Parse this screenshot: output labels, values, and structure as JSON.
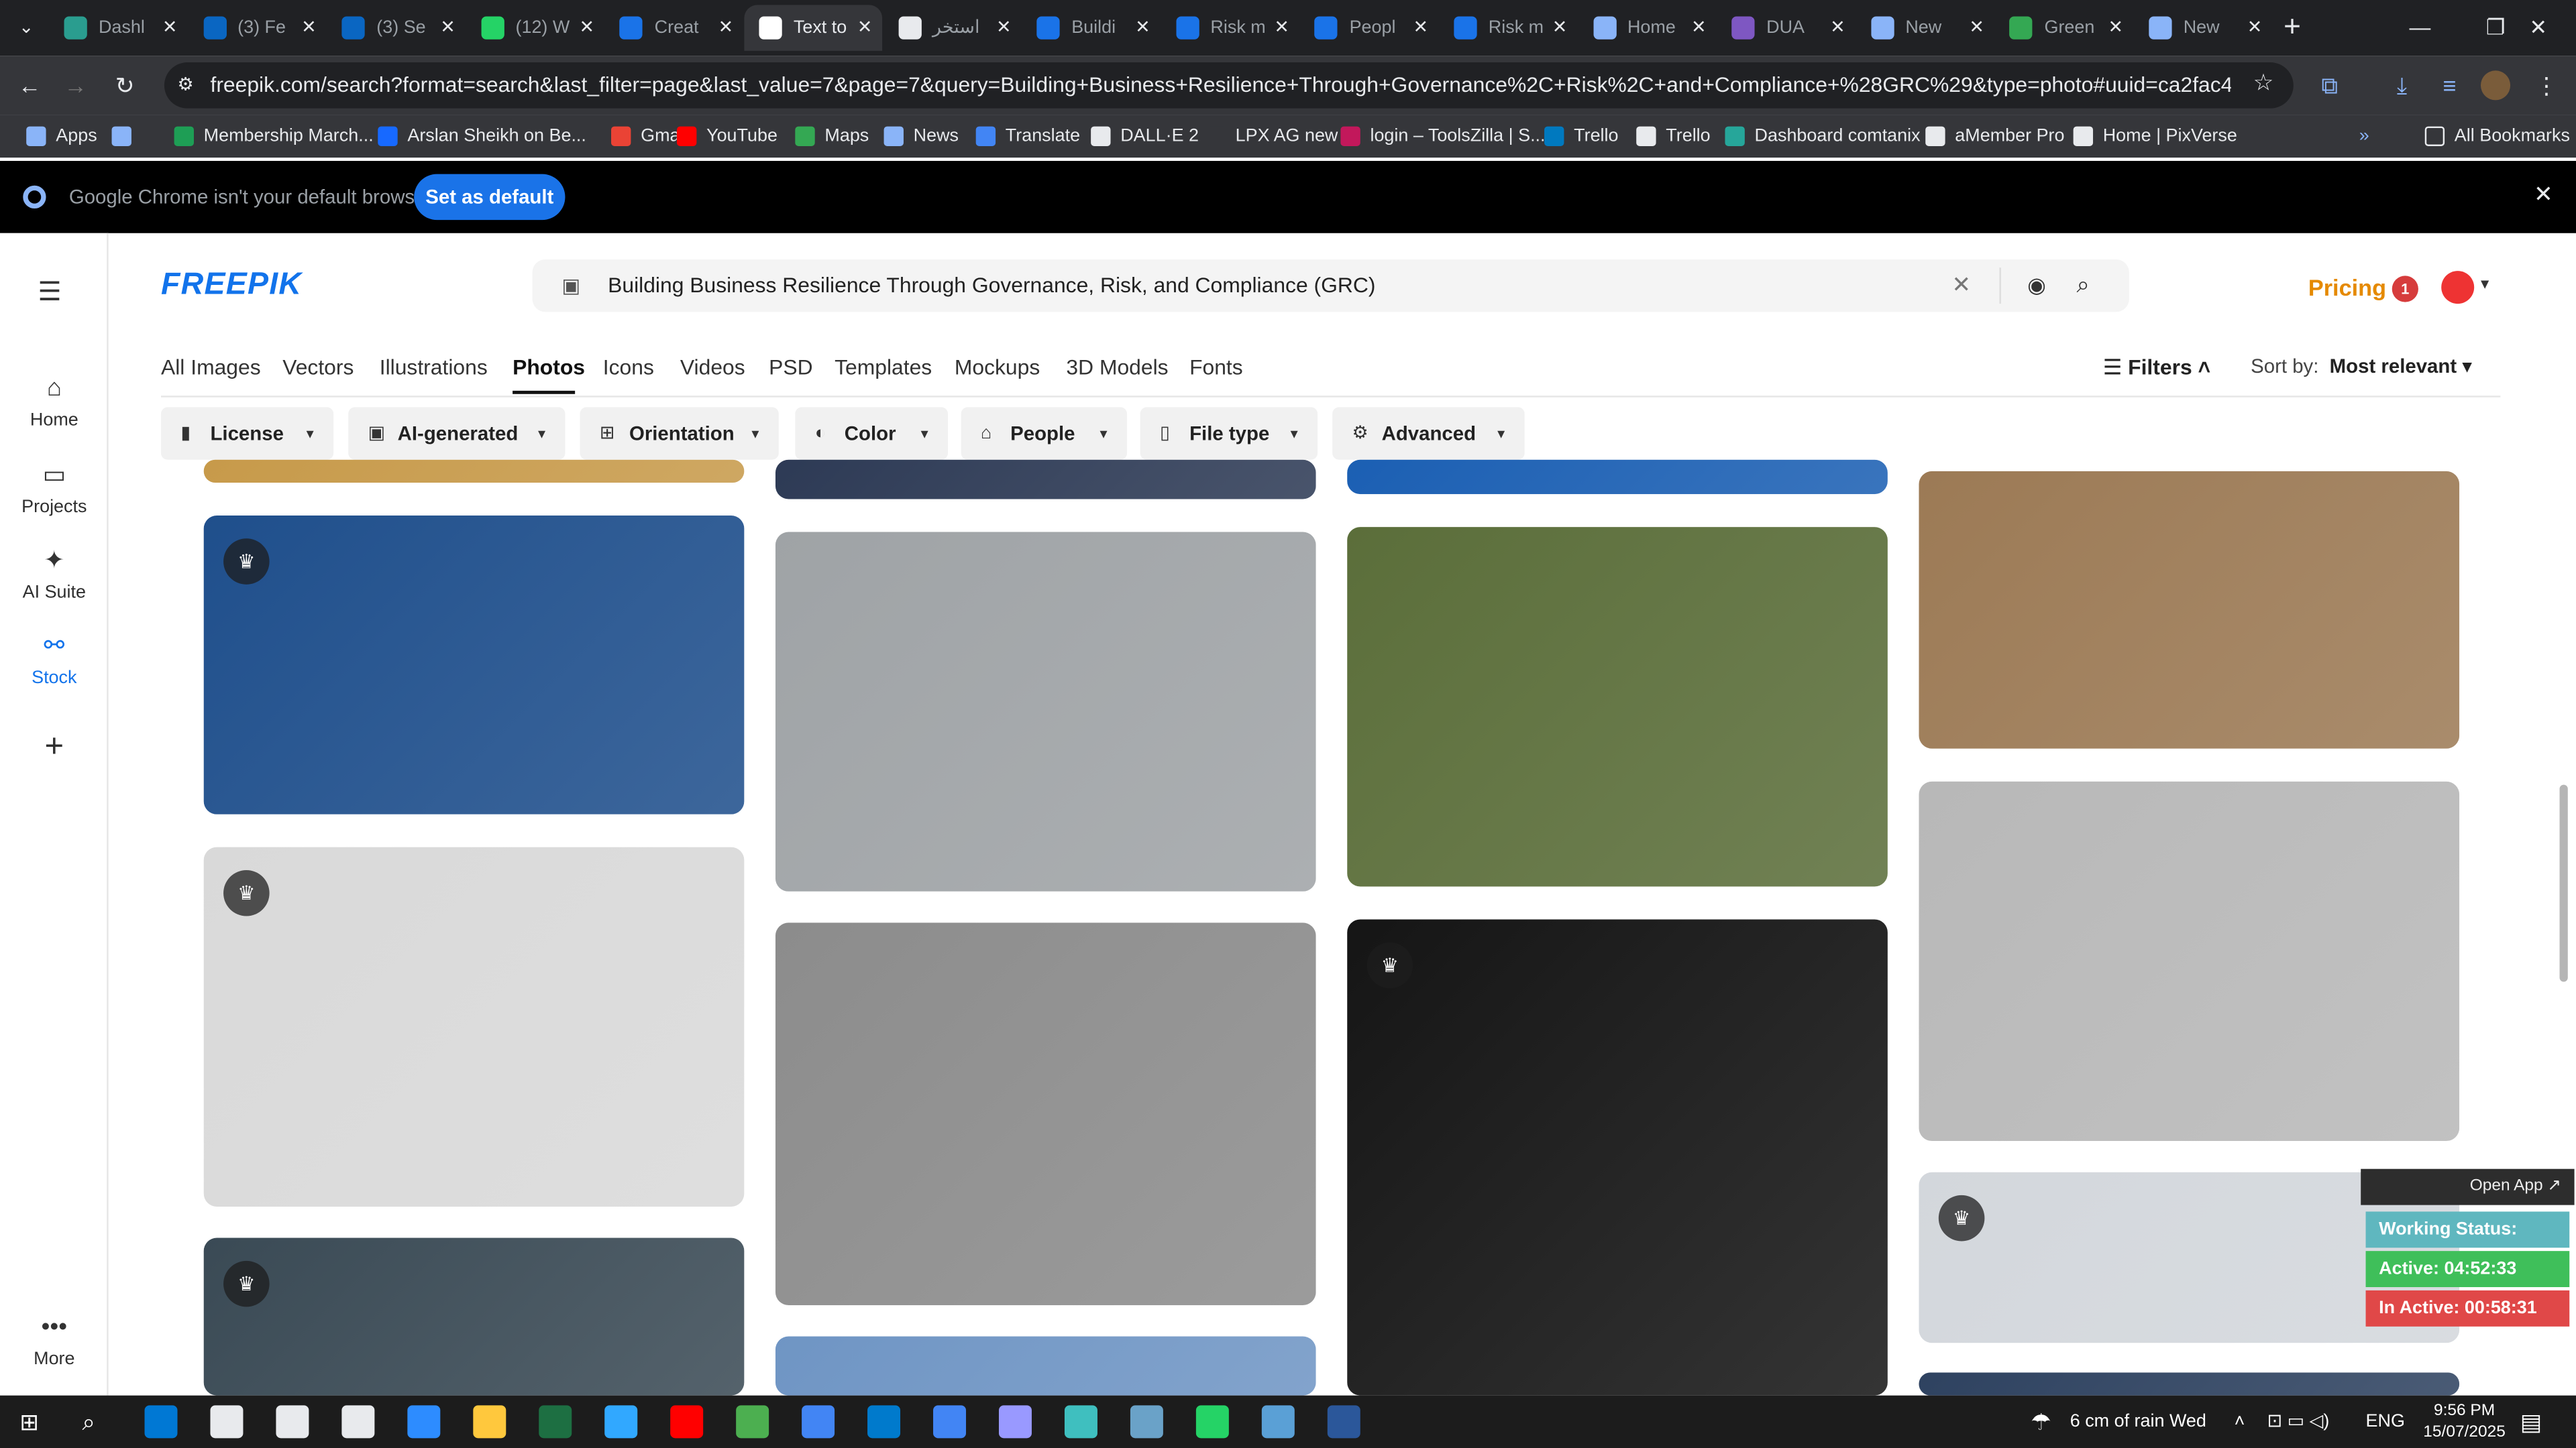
{
  "browser": {
    "tabs": [
      {
        "label": "Dashl",
        "color": "#2a9d8f",
        "active": false
      },
      {
        "label": "(3) Fe",
        "color": "#0a66c2",
        "active": false
      },
      {
        "label": "(3) Se",
        "color": "#0a66c2",
        "active": false
      },
      {
        "label": "(12) W",
        "color": "#25d366",
        "active": false
      },
      {
        "label": "Creat",
        "color": "#1a73e8",
        "active": false
      },
      {
        "label": "Text to",
        "color": "#ffffff",
        "active": true
      },
      {
        "label": "استخر",
        "color": "#e8eaed",
        "active": false
      },
      {
        "label": "Buildi",
        "color": "#1a73e8",
        "active": false
      },
      {
        "label": "Risk m",
        "color": "#1a73e8",
        "active": false
      },
      {
        "label": "Peopl",
        "color": "#1a73e8",
        "active": false
      },
      {
        "label": "Risk m",
        "color": "#1a73e8",
        "active": false
      },
      {
        "label": "Home",
        "color": "#8ab4f8",
        "active": false
      },
      {
        "label": "DUA",
        "color": "#7e57c2",
        "active": false
      },
      {
        "label": "New",
        "color": "#8ab4f8",
        "active": false
      },
      {
        "label": "Green",
        "color": "#34a853",
        "active": false
      },
      {
        "label": "New",
        "color": "#8ab4f8",
        "active": false
      }
    ],
    "url": "freepik.com/search?format=search&last_filter=page&last_value=7&page=7&query=Building+Business+Resilience+Through+Governance%2C+Risk%2C+and+Compliance+%28GRC%29&type=photo#uuid=ca2fac46-376d-4ca8-8abf-f91f3712...",
    "bookmarks": [
      {
        "label": "Apps",
        "color": "#8ab4f8"
      },
      {
        "label": "",
        "color": "#8ab4f8"
      },
      {
        "label": "Membership March...",
        "color": "#1e9e55"
      },
      {
        "label": "Arslan Sheikh on Be...",
        "color": "#1769ff"
      },
      {
        "label": "Gmail",
        "color": "#ea4335"
      },
      {
        "label": "YouTube",
        "color": "#ff0000"
      },
      {
        "label": "Maps",
        "color": "#34a853"
      },
      {
        "label": "News",
        "color": "#8ab4f8"
      },
      {
        "label": "Translate",
        "color": "#4285f4"
      },
      {
        "label": "DALL·E 2",
        "color": "#e8eaed"
      },
      {
        "label": "LPX AG new",
        "color": "#35363a"
      },
      {
        "label": "login – ToolsZilla | S...",
        "color": "#c2185b"
      },
      {
        "label": "Trello",
        "color": "#0079bf"
      },
      {
        "label": "Trello",
        "color": "#e8eaed"
      },
      {
        "label": "Dashboard comtanix",
        "color": "#26a69a"
      },
      {
        "label": "aMember Pro",
        "color": "#e8eaed"
      },
      {
        "label": "Home | PixVerse",
        "color": "#e8eaed"
      }
    ],
    "all_bookmarks": "All Bookmarks",
    "infobar_msg": "Google Chrome isn't your default browser",
    "set_default": "Set as default"
  },
  "rail": {
    "items": [
      {
        "label": "Home",
        "icon": "⌂"
      },
      {
        "label": "Projects",
        "icon": "▭"
      },
      {
        "label": "AI Suite",
        "icon": "✦"
      },
      {
        "label": "Stock",
        "icon": "⚯"
      }
    ],
    "plus": "+",
    "more": "More"
  },
  "header": {
    "logo": "FREEPIK",
    "query": "Building Business Resilience Through Governance, Risk, and Compliance (GRC)",
    "pricing": "Pricing",
    "notif_count": "1"
  },
  "categories": [
    "All Images",
    "Vectors",
    "Illustrations",
    "Photos",
    "Icons",
    "Videos",
    "PSD",
    "Templates",
    "Mockups",
    "3D Models",
    "Fonts"
  ],
  "active_category": "Photos",
  "filters_label": "Filters",
  "sort_label": "Sort by:",
  "sort_value": "Most relevant",
  "chips": [
    {
      "label": "License",
      "icon": "▮"
    },
    {
      "label": "AI-generated",
      "icon": "▣"
    },
    {
      "label": "Orientation",
      "icon": "⊞"
    },
    {
      "label": "Color",
      "icon": "◐"
    },
    {
      "label": "People",
      "icon": "⌂"
    },
    {
      "label": "File type",
      "icon": "▯"
    },
    {
      "label": "Advanced",
      "icon": "⚙"
    }
  ],
  "tiles": [
    {
      "name": "tile-col1-top-partial",
      "bg": "#c79a4a",
      "premium": false
    },
    {
      "name": "tile-binders-figures",
      "bg": "#1f4f8c",
      "premium": true
    },
    {
      "name": "tile-stairs-umbrella",
      "bg": "#d9d9d9",
      "premium": true
    },
    {
      "name": "tile-risk-management",
      "bg": "#3a4a55",
      "premium": true
    },
    {
      "name": "tile-col2-top-partial",
      "bg": "#2d3a55",
      "premium": false
    },
    {
      "name": "tile-hourglass-watch",
      "bg": "#9fa3a6",
      "premium": false
    },
    {
      "name": "tile-spiral-stairs-man",
      "bg": "#8c8c8c",
      "premium": false
    },
    {
      "name": "tile-col2-bottom-partial",
      "bg": "#6f95c4",
      "premium": false
    },
    {
      "name": "tile-col3-top-partial",
      "bg": "#1b5fb3",
      "premium": false
    },
    {
      "name": "tile-meeting-green-wall",
      "bg": "#5b6e3a",
      "premium": false
    },
    {
      "name": "tile-figurines-colors",
      "bg": "#151515",
      "premium": true
    },
    {
      "name": "tile-meeting-table-top",
      "bg": "#9c7a55",
      "premium": false
    },
    {
      "name": "tile-office-meeting",
      "bg": "#b8b8b8",
      "premium": false
    },
    {
      "name": "tile-compass-network",
      "bg": "#d3d7dc",
      "premium": true
    },
    {
      "name": "tile-col4-bottom-partial",
      "bg": "#2e4260",
      "premium": false
    }
  ],
  "widget": {
    "open_app": "Open App ↗",
    "status": "Working Status: Active",
    "active": "Active: 04:52:33",
    "inactive": "In Active: 00:58:31"
  },
  "taskbar": {
    "weather": "6 cm of rain Wed",
    "lang": "ENG",
    "time": "9:56 PM",
    "date": "15/07/2025",
    "apps": [
      "#0078d4",
      "#e8eaed",
      "#e8eaed",
      "#e8eaed",
      "#2d8cff",
      "#ffc83d",
      "#1d6f42",
      "#31a8ff",
      "#ff0000",
      "#4caf50",
      "#4285f4",
      "#007acc",
      "#4285f4",
      "#9999ff",
      "#3fbfbf",
      "#6aa2c8",
      "#25d366",
      "#5aa0d6",
      "#2b579a"
    ]
  }
}
